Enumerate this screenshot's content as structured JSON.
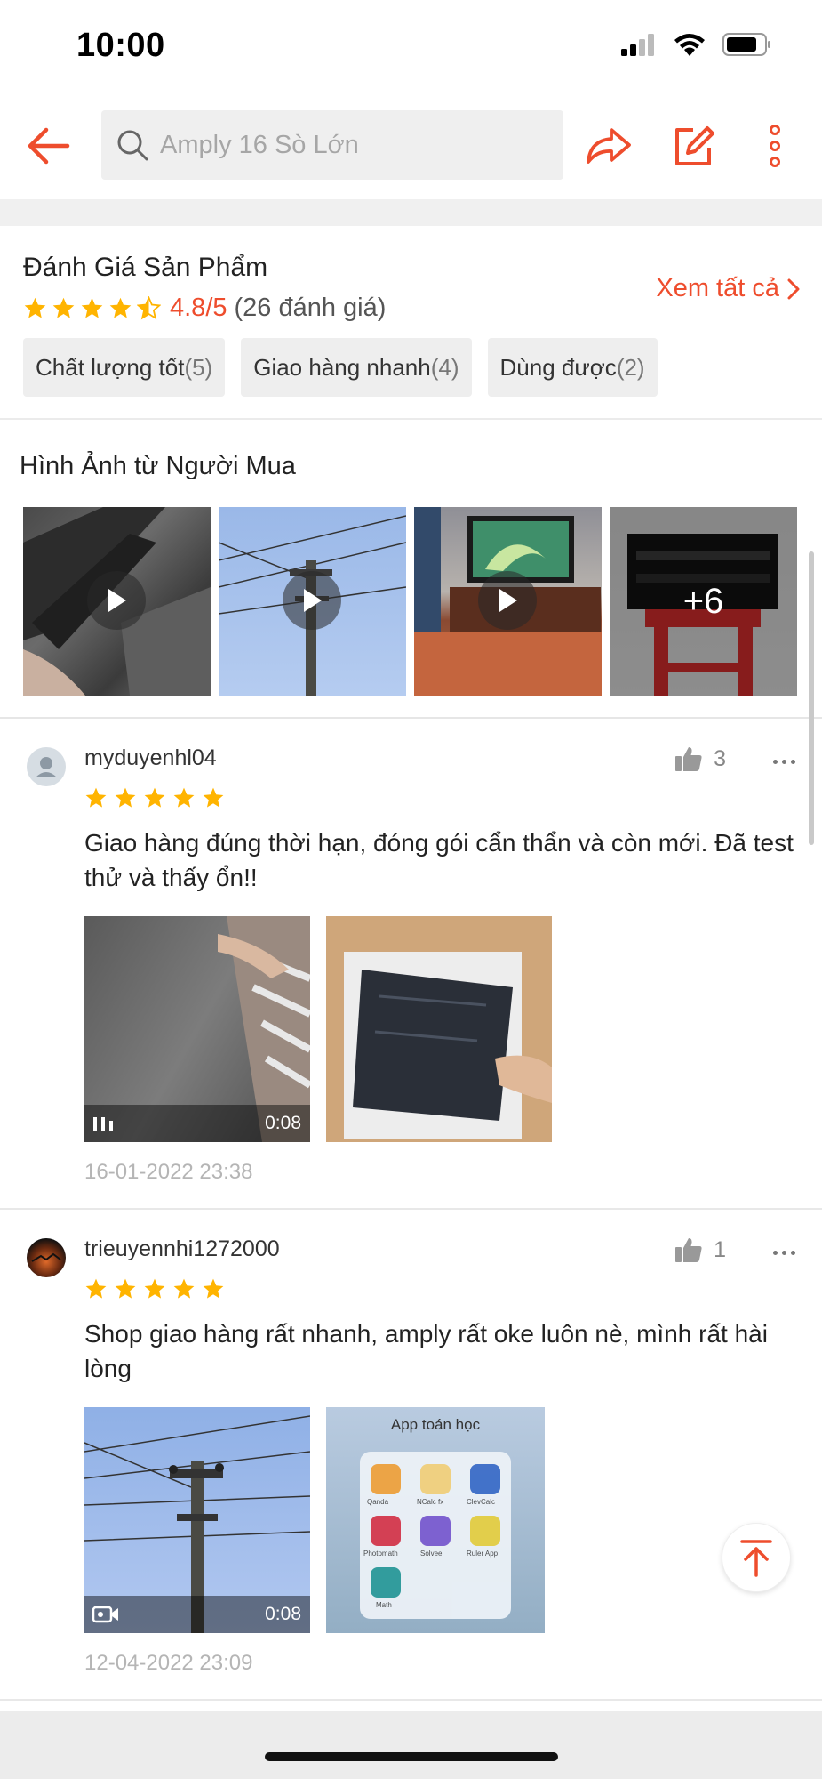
{
  "status": {
    "time": "10:00"
  },
  "search": {
    "placeholder": "Amply 16 Sò Lớn"
  },
  "rating": {
    "title": "Đánh Giá Sản Phẩm",
    "score": "4.8/5",
    "count": "(26 đánh giá)",
    "stars": 4.5,
    "view_all": "Xem tất cả"
  },
  "chips": [
    {
      "label": "Chất lượng tốt",
      "count": "(5)"
    },
    {
      "label": "Giao hàng nhanh",
      "count": "(4)"
    },
    {
      "label": "Dùng được",
      "count": "(2)"
    }
  ],
  "buyer_photos": {
    "title": "Hình Ảnh từ Người Mua",
    "more": "+6"
  },
  "reviews": [
    {
      "user": "myduyenhl04",
      "likes": "3",
      "stars": 5,
      "text": "Giao hàng đúng thời hạn, đóng gói cẩn thẩn và còn mới. Đã test thử và thấy ổn!!",
      "video_duration": "0:08",
      "date": "16-01-2022 23:38"
    },
    {
      "user": "trieuyennhi1272000",
      "likes": "1",
      "stars": 5,
      "text": "Shop giao hàng rất nhanh, amply rất oke luôn nè, mình rất hài lòng",
      "video_duration": "0:08",
      "date": "12-04-2022 23:09",
      "image_text": {
        "title": "App toán học",
        "apps": [
          "Qanda",
          "NCalc fx",
          "ClevCalc",
          "Photomath",
          "Solvee",
          "Ruler App",
          "Math"
        ]
      }
    }
  ],
  "colors": {
    "accent": "#ee4d2d",
    "star": "#ffb400"
  }
}
